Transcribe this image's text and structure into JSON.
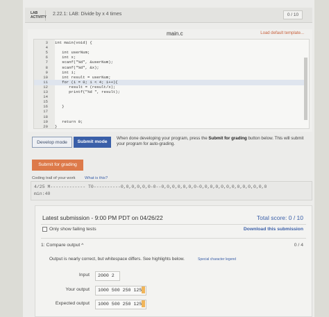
{
  "header": {
    "lab_label": "LAB ACTIVITY",
    "title": "2.22.1: LAB: Divide by x 4 times",
    "score": "0 / 10"
  },
  "editor": {
    "file_name": "main.c",
    "load_default": "Load default template...",
    "lines": [
      {
        "n": "3",
        "code": "int main(void) {"
      },
      {
        "n": "4",
        "code": ""
      },
      {
        "n": "5",
        "code": "   int userNum;"
      },
      {
        "n": "6",
        "code": "   int x;"
      },
      {
        "n": "7",
        "code": "   scanf(\"%d\", &userNum);"
      },
      {
        "n": "8",
        "code": "   scanf(\"%d\", &x);"
      },
      {
        "n": "9",
        "code": "   int i;"
      },
      {
        "n": "10",
        "code": "   int result = userNum;"
      },
      {
        "n": "11",
        "code": "   for (i = 0; i < 4; i++){"
      },
      {
        "n": "12",
        "code": "      result = (result/x);"
      },
      {
        "n": "13",
        "code": "      printf(\"%d \", result);"
      },
      {
        "n": "14",
        "code": ""
      },
      {
        "n": "15",
        "code": ""
      },
      {
        "n": "16",
        "code": "   }"
      },
      {
        "n": "17",
        "code": ""
      },
      {
        "n": "18",
        "code": ""
      },
      {
        "n": "19",
        "code": "   return 0;"
      },
      {
        "n": "20",
        "code": "}"
      }
    ]
  },
  "controls": {
    "develop_mode": "Develop mode",
    "submit_mode": "Submit mode",
    "help_prefix": "When done developing your program, press the ",
    "help_bold": "Submit for grading",
    "help_suffix": " button below. This will submit your program for auto-grading.",
    "submit_for_grading": "Submit for grading"
  },
  "trail": {
    "label": "Coding trail of your work",
    "link": "What is this?",
    "line1": "4/25 M------------- T0----------0,0,0,0,0,0-0--0,0,0,0,0,0,0-0,0,0,0,0,0,0,0,0,0,0,0,0",
    "line2": "min:40"
  },
  "results": {
    "latest": "Latest submission - 9:00 PM PDT on 04/26/22",
    "total": "Total score: 0 / 10",
    "only_failing": "Only show failing tests",
    "download": "Download this submission",
    "compare": "1: Compare output ^",
    "compare_score": "0 / 4",
    "nearly": "Output is nearly correct, but whitespace differs. See highlights below.",
    "legend": "Special character legend",
    "input_label": "Input",
    "input_value": "2000 2",
    "your_output_label": "Your output",
    "your_output_value": "1000 500 250 125",
    "expected_label": "Expected output",
    "expected_value": "1000 500 250 125"
  }
}
